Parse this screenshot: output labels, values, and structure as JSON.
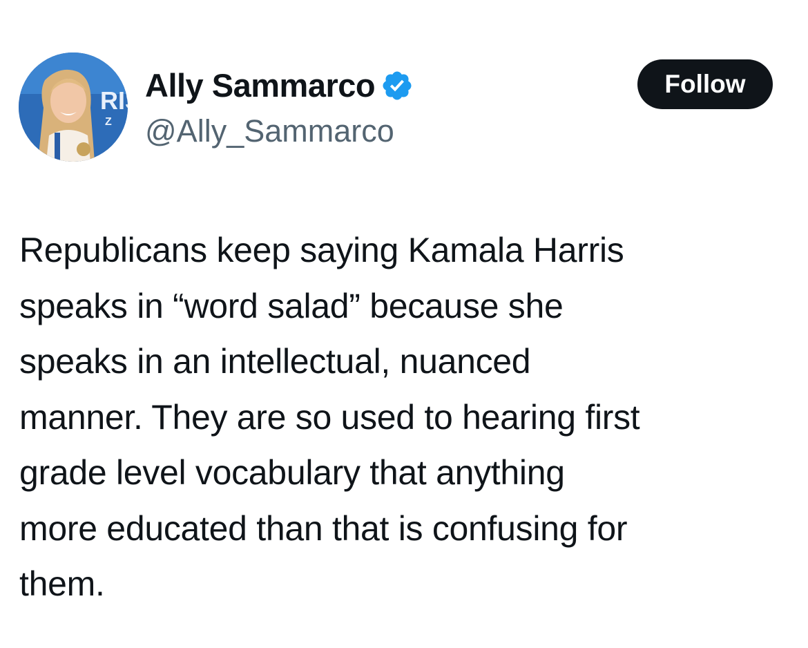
{
  "author": {
    "display_name": "Ally Sammarco",
    "handle": "@Ally_Sammarco",
    "verified": true,
    "verified_icon": "verified-badge-icon",
    "avatar_backdrop_text": [
      "RIS",
      "Z"
    ]
  },
  "actions": {
    "follow_label": "Follow"
  },
  "tweet": {
    "lines": [
      "Republicans keep saying Kamala Harris",
      "speaks in “word salad” because she",
      "speaks in an intellectual, nuanced",
      "manner. They are so used to hearing first",
      "grade level vocabulary that anything",
      "more educated than that is confusing for",
      "them."
    ]
  },
  "colors": {
    "text": "#0f1419",
    "secondary_text": "#536471",
    "verified_blue": "#1d9bf0",
    "follow_bg": "#0f1419",
    "follow_text": "#ffffff",
    "background": "#ffffff"
  }
}
